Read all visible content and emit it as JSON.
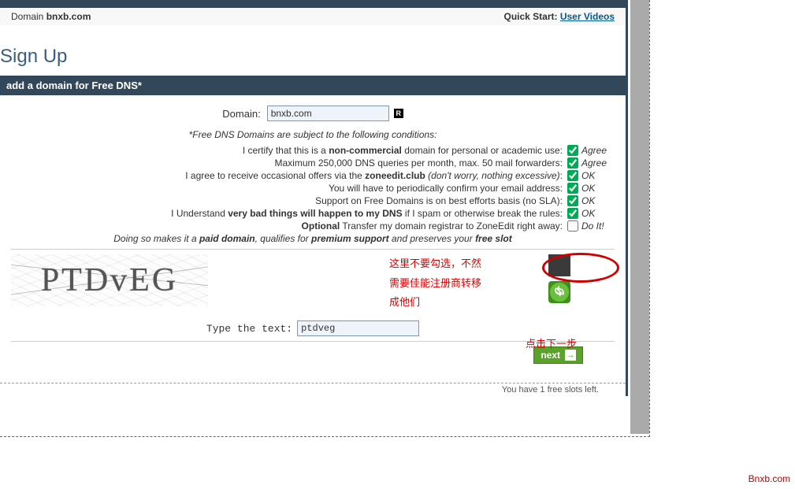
{
  "header": {
    "domain_label_prefix": "Domain ",
    "domain_value": "bnxb.com",
    "quickstart_label": "Quick Start: ",
    "quickstart_link": "User Videos"
  },
  "page": {
    "title": "Sign Up",
    "section_bar": "add a domain for Free DNS*"
  },
  "form": {
    "domain_label": "Domain:",
    "domain_value": "bnxb.com",
    "badge": "R",
    "conditions_heading": "*Free DNS Domains are subject to the following conditions:",
    "conditions": [
      {
        "pre": "I certify that this is a ",
        "bold": "non-commercial",
        "post": " domain for personal or academic use:",
        "checked": true,
        "ack": "Agree"
      },
      {
        "pre": "Maximum 250,000 DNS queries per month, max. 50 mail forwarders:",
        "bold": "",
        "post": "",
        "checked": true,
        "ack": "Agree"
      },
      {
        "pre": "I agree to receive occasional offers via the ",
        "bold": "zoneedit.club",
        "post_italic": " (don't worry, nothing excessive)",
        "post": ":",
        "checked": true,
        "ack": "OK"
      },
      {
        "pre": "You will have to periodically confirm your email address:",
        "bold": "",
        "post": "",
        "checked": true,
        "ack": "OK"
      },
      {
        "pre": "Support on Free Domains is on best efforts basis (no SLA):",
        "bold": "",
        "post": "",
        "checked": true,
        "ack": "OK"
      },
      {
        "pre": "I Understand ",
        "bold": "very bad things will happen to my DNS",
        "post": " if I spam or otherwise break the rules:",
        "checked": true,
        "ack": "OK"
      },
      {
        "pre_bold": "Optional",
        "pre": " Transfer my domain registrar to ZoneEdit right away:",
        "bold": "",
        "post": "",
        "checked": false,
        "ack": "Do It!"
      }
    ],
    "optional_note_pre": "Doing so makes it a ",
    "optional_note_b1": "paid domain",
    "optional_note_mid": ", qualifies for ",
    "optional_note_b2": "premium support",
    "optional_note_mid2": " and preserves your ",
    "optional_note_b3": "free slot",
    "captcha_text": "PTDvEG",
    "type_label": "Type the text:",
    "captcha_value": "ptdveg",
    "next_label": "next"
  },
  "annotations": {
    "warn_lines": [
      "这里不要勾选，不然",
      "需要佳能注册商转移",
      "成他们"
    ],
    "next_hint": "点击下一步"
  },
  "footer": {
    "slots_text": "You have 1 free slots left."
  },
  "watermark": "Bnxb.com"
}
